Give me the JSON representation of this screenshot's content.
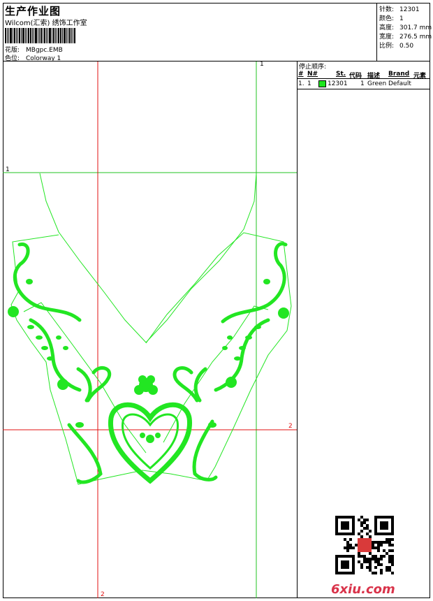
{
  "header": {
    "title": "生产作业图",
    "company": "Wilcom(汇索) 绣饰工作室",
    "design_label": "花版:",
    "design_value": "MBgpc.EMB",
    "colorway_label": "色位:",
    "colorway_value": "Colorway 1"
  },
  "stats": [
    {
      "label": "针数:",
      "value": "12301"
    },
    {
      "label": "颜色:",
      "value": "1"
    },
    {
      "label": "高度:",
      "value": "301.7 mm"
    },
    {
      "label": "宽度:",
      "value": "276.5 mm"
    },
    {
      "label": "比例:",
      "value": "0.50"
    }
  ],
  "guides": {
    "top_label": "1",
    "left_label": "1",
    "right_label": "2",
    "bottom_label": "2",
    "guide_color": "#22c322",
    "ref_color": "#e01010"
  },
  "panel": {
    "caption": "停止顺序:",
    "headers": {
      "num": "#",
      "n": "N#",
      "st": "St.",
      "code": "代码",
      "desc": "描述",
      "brand": "Brand",
      "elem": "元素"
    },
    "row": {
      "num": "1.",
      "n": "1",
      "st": "12301",
      "code": "1",
      "desc": "Green",
      "brand": "Default"
    },
    "thread_color": "#1ee61e"
  },
  "embroidery_color": "#22e622",
  "watermark": "6xiu.com"
}
